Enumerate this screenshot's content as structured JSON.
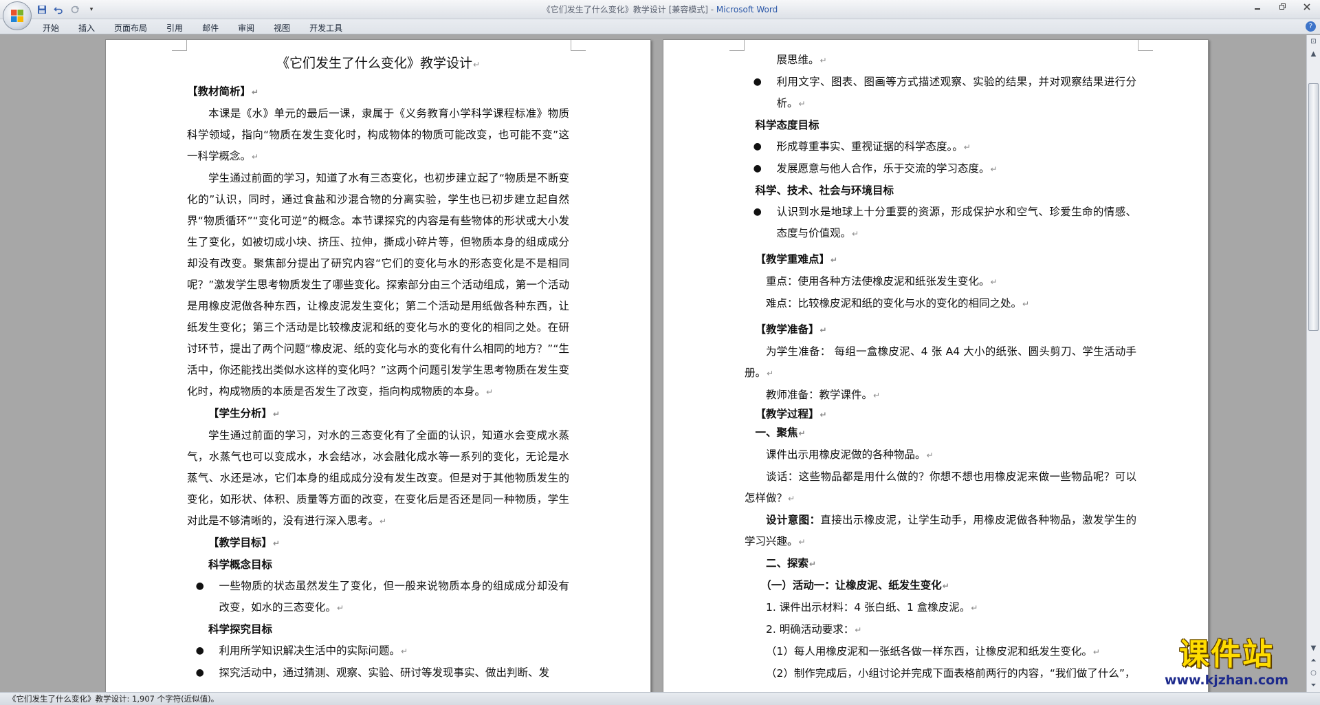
{
  "window": {
    "title_doc": "《它们发生了什么变化》教学设计 [兼容模式] - ",
    "title_app": "Microsoft Word"
  },
  "qat": {
    "save_icon": "save-icon",
    "undo_icon": "undo-icon",
    "redo_icon": "redo-icon",
    "customize_icon": "dropdown-icon"
  },
  "ribbon": {
    "tabs": [
      "开始",
      "插入",
      "页面布局",
      "引用",
      "邮件",
      "审阅",
      "视图",
      "开发工具"
    ],
    "help": "?"
  },
  "status": {
    "text": "《它们发生了什么变化》教学设计: 1,907 个字符(近似值)。"
  },
  "watermark": {
    "cn": "课件站",
    "url": "www.kjzhan.com"
  },
  "left_page": {
    "title": "《它们发生了什么变化》教学设计",
    "s1_head": "【教材简析】",
    "s1_p1": "本课是《水》单元的最后一课，隶属于《义务教育小学科学课程标准》物质科学领域，指向“物质在发生变化时，构成物体的物质可能改变，也可能不变”这一科学概念。",
    "s1_p2": "学生通过前面的学习，知道了水有三态变化，也初步建立起了“物质是不断变化的”认识，同时，通过食盐和沙混合物的分离实验，学生也已初步建立起自然界“物质循环”“变化可逆”的概念。本节课探究的内容是有些物体的形状或大小发生了变化，如被切成小块、挤压、拉伸，撕成小碎片等，但物质本身的组成成分却没有改变。聚焦部分提出了研究内容“它们的变化与水的形态变化是不是相同呢？”激发学生思考物质发生了哪些变化。探索部分由三个活动组成，第一个活动是用橡皮泥做各种东西，让橡皮泥发生变化；第二个活动是用纸做各种东西，让纸发生变化；第三个活动是比较橡皮泥和纸的变化与水的变化的相同之处。在研讨环节，提出了两个问题“橡皮泥、纸的变化与水的变化有什么相同的地方？”“生活中，你还能找出类似水这样的变化吗？”这两个问题引发学生思考物质在发生变化时，构成物质的本质是否发生了改变，指向构成物质的本身。",
    "s2_head": "【学生分析】",
    "s2_p1": "学生通过前面的学习，对水的三态变化有了全面的认识，知道水会变成水蒸气，水蒸气也可以变成水，水会结冰，冰会融化成水等一系列的变化，无论是水蒸气、水还是冰，它们本身的组成成分没有发生改变。但是对于其他物质发生的变化，如形状、体积、质量等方面的改变，在变化后是否还是同一种物质，学生对此是不够清晰的，没有进行深入思考。",
    "s3_head": "【教学目标】",
    "g1_head": "科学概念目标",
    "g1_b1": "一些物质的状态虽然发生了变化，但一般来说物质本身的组成成分却没有改变，如水的三态变化。",
    "g2_head": "科学探究目标",
    "g2_b1": "利用所学知识解决生活中的实际问题。",
    "g2_b2": "探究活动中，通过猜测、观察、实验、研讨等发现事实、做出判断、发"
  },
  "right_page": {
    "cont_line": "展思维。",
    "g2_b3": "利用文字、图表、图画等方式描述观察、实验的结果，并对观察结果进行分析。",
    "g3_head": "科学态度目标",
    "g3_b1": "形成尊重事实、重视证据的科学态度。。",
    "g3_b2": "发展愿意与他人合作，乐于交流的学习态度。",
    "g4_head": "科学、技术、社会与环境目标",
    "g4_b1": "认识到水是地球上十分重要的资源，形成保护水和空气、珍爱生命的情感、态度与价值观。",
    "s4_head": "【教学重难点】",
    "s4_p1": "重点：使用各种方法使橡皮泥和纸张发生变化。",
    "s4_p2": "难点：比较橡皮泥和纸的变化与水的变化的相同之处。",
    "s5_head": "【教学准备】",
    "s5_p1": "为学生准备： 每组一盒橡皮泥、4 张 A4 大小的纸张、圆头剪刀、学生活动手册。",
    "s5_p2": "教师准备：教学课件。",
    "s6_head": "【教学过程】",
    "step1_head": "一、聚焦",
    "step1_p1": "课件出示用橡皮泥做的各种物品。",
    "step1_p2": "谈话：这些物品都是用什么做的？你想不想也用橡皮泥来做一些物品呢？可以怎样做？",
    "step1_p3_bold": "设计意图：",
    "step1_p3": "直接出示橡皮泥，让学生动手，用橡皮泥做各种物品，激发学生的学习兴趣。",
    "step2_head": "二、探索",
    "act1_head": "（一）活动一：让橡皮泥、纸发生变化",
    "act1_l1": "1. 课件出示材料：4 张白纸、1 盒橡皮泥。",
    "act1_l2": "2. 明确活动要求：",
    "act1_l3": "（1）每人用橡皮泥和一张纸各做一样东西，让橡皮泥和纸发生变化。",
    "act1_l4": "（2）制作完成后，小组讨论并完成下面表格前两行的内容，“我们做了什么”，"
  }
}
